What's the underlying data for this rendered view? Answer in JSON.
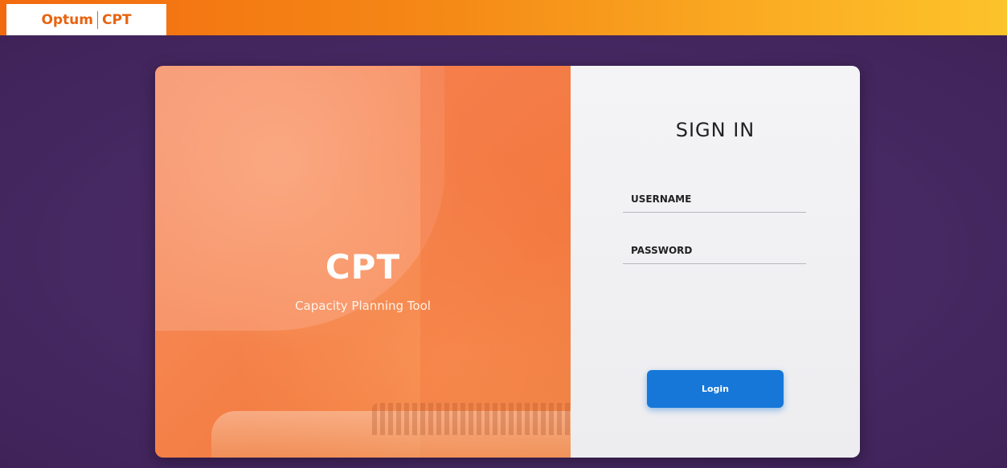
{
  "header": {
    "brand_left": "Optum",
    "brand_right": "CPT"
  },
  "hero": {
    "title": "CPT",
    "subtitle": "Capacity Planning Tool"
  },
  "signin": {
    "title": "SIGN IN",
    "username_placeholder": "USERNAME",
    "password_placeholder": "PASSWORD",
    "login_label": "Login"
  },
  "colors": {
    "accent": "#1677d8",
    "brand_orange": "#e8630f",
    "background": "#4a2b60"
  }
}
